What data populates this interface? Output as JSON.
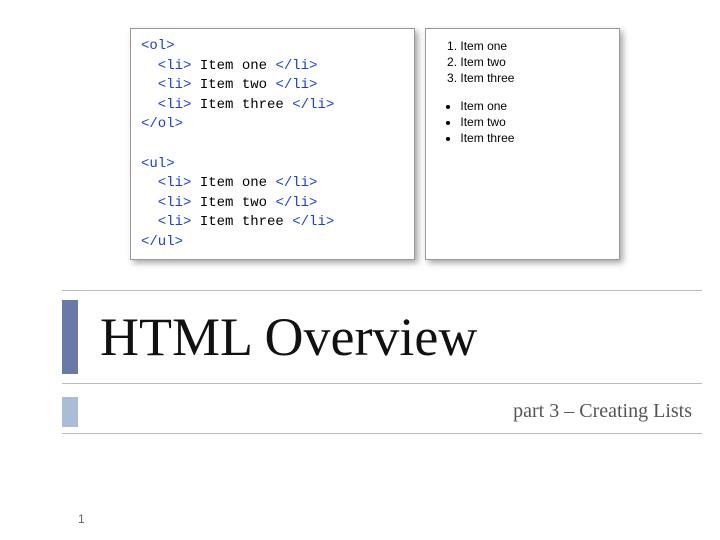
{
  "code": {
    "ol_open": "<ol>",
    "ol_li1_open": "  <li>",
    "ol_li1_text": " Item one ",
    "ol_li1_close": "</li>",
    "ol_li2_open": "  <li>",
    "ol_li2_text": " Item two ",
    "ol_li2_close": "</li>",
    "ol_li3_open": "  <li>",
    "ol_li3_text": " Item three ",
    "ol_li3_close": "</li>",
    "ol_close": "</ol>",
    "ul_open": "<ul>",
    "ul_li1_open": "  <li>",
    "ul_li1_text": " Item one ",
    "ul_li1_close": "</li>",
    "ul_li2_open": "  <li>",
    "ul_li2_text": " Item two ",
    "ul_li2_close": "</li>",
    "ul_li3_open": "  <li>",
    "ul_li3_text": " Item three ",
    "ul_li3_close": "</li>",
    "ul_close": "</ul>"
  },
  "rendered": {
    "ol": [
      "Item one",
      "Item two",
      "Item three"
    ],
    "ul": [
      "Item one",
      "Item two",
      "Item three"
    ]
  },
  "title": "HTML Overview",
  "subtitle": "part 3 – Creating Lists",
  "slide_number": "1"
}
